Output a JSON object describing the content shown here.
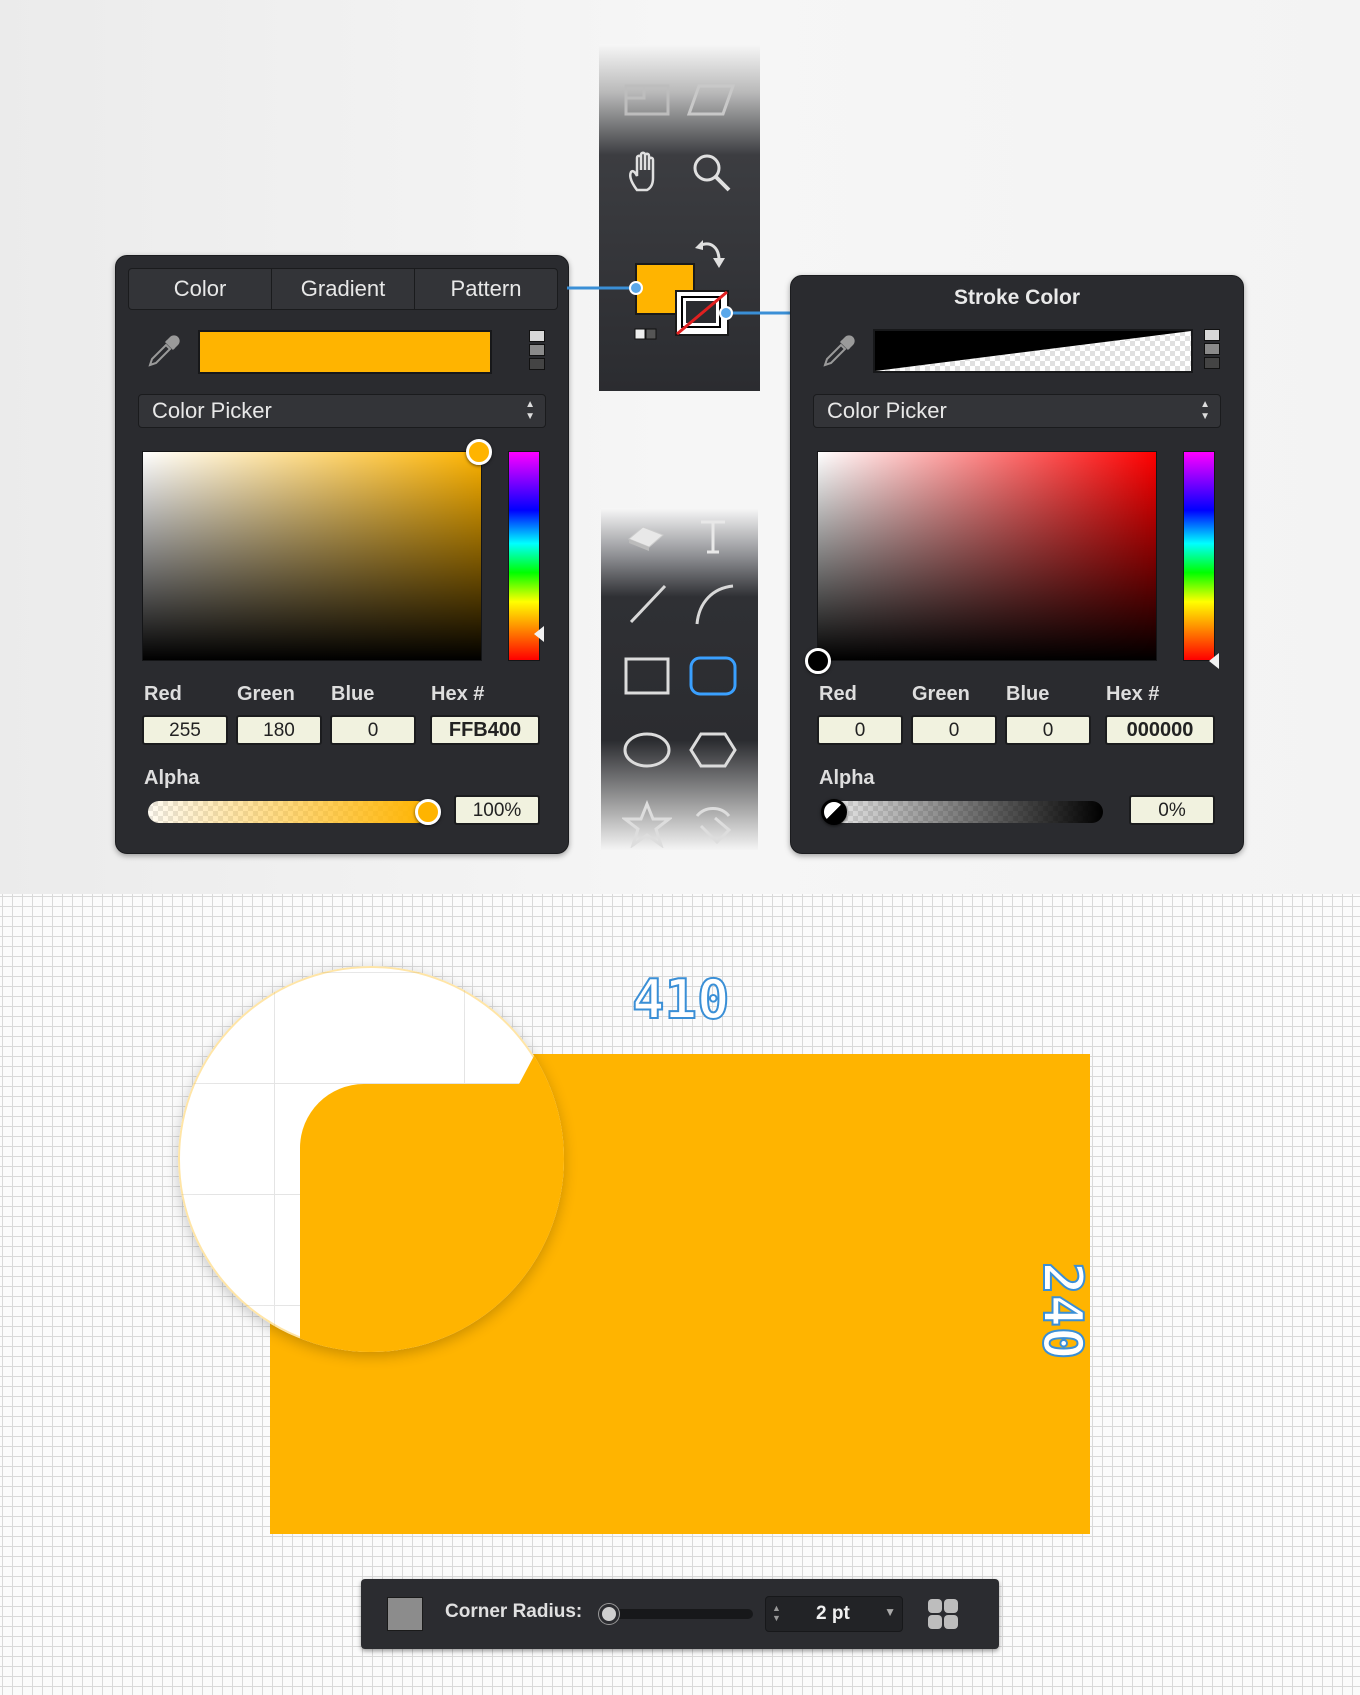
{
  "fill_panel": {
    "tabs": [
      "Color",
      "Gradient",
      "Pattern"
    ],
    "mode": "Color Picker",
    "swatch_color": "#FFB400",
    "labels": {
      "red": "Red",
      "green": "Green",
      "blue": "Blue",
      "hex": "Hex #",
      "alpha": "Alpha"
    },
    "values": {
      "red": "255",
      "green": "180",
      "blue": "0",
      "hex": "FFB400",
      "alpha": "100%"
    },
    "alpha_level": 1.0
  },
  "stroke_panel": {
    "title": "Stroke Color",
    "mode": "Color Picker",
    "labels": {
      "red": "Red",
      "green": "Green",
      "blue": "Blue",
      "hex": "Hex #",
      "alpha": "Alpha"
    },
    "values": {
      "red": "0",
      "green": "0",
      "blue": "0",
      "hex": "000000",
      "alpha": "0%"
    },
    "alpha_level": 0.0
  },
  "toolbar_top": {
    "icons": [
      "frame-tool-icon",
      "skew-tool-icon",
      "hand-tool-icon",
      "zoom-tool-icon",
      "swap-colors-icon",
      "default-colors-icon"
    ],
    "fill_color": "#FFB400"
  },
  "toolbar_shapes": {
    "icons": [
      "eraser-tool-icon",
      "text-tool-icon",
      "line-tool-icon",
      "arc-tool-icon",
      "rectangle-tool-icon",
      "rounded-rectangle-tool-icon",
      "ellipse-tool-icon",
      "polygon-tool-icon",
      "star-tool-icon",
      "spiral-tool-icon"
    ],
    "selected": "rounded-rectangle-tool-icon"
  },
  "canvas": {
    "width_label": "410",
    "height_label": "240",
    "shape_color": "#FFB400"
  },
  "bottom_bar": {
    "corner_label": "Corner Radius:",
    "corner_value": "2 pt",
    "corner_slider_level": 0.0
  },
  "colors": {
    "accent_blue": "#3a8fd6",
    "panel_bg": "#2a2b2f"
  }
}
